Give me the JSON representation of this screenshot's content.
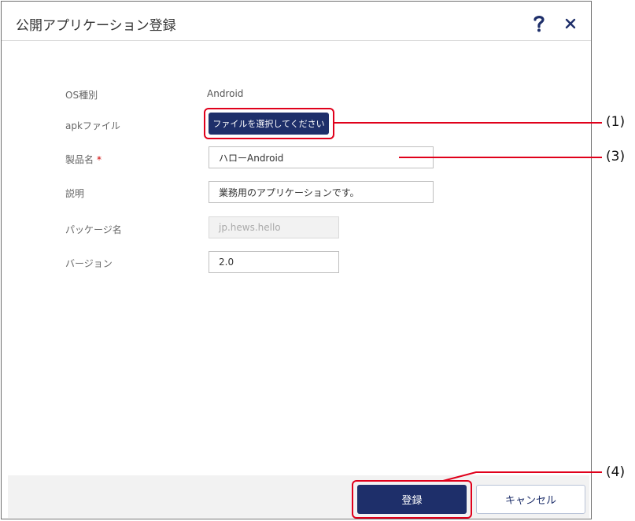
{
  "dialog": {
    "title": "公開アプリケーション登録",
    "help_icon": "help-icon",
    "close_icon": "close-icon"
  },
  "form": {
    "os_type": {
      "label": "OS種別",
      "value": "Android"
    },
    "apk_file": {
      "label": "apkファイル",
      "button_label": "ファイルを選択してください"
    },
    "product_name": {
      "label": "製品名",
      "required_mark": "*",
      "value": "ハローAndroid"
    },
    "description": {
      "label": "説明",
      "value": "業務用のアプリケーションです。"
    },
    "package_name": {
      "label": "パッケージ名",
      "value": "jp.hews.hello"
    },
    "version": {
      "label": "バージョン",
      "value": "2.0"
    }
  },
  "footer": {
    "submit_label": "登録",
    "cancel_label": "キャンセル"
  },
  "callouts": {
    "c1": "(1)",
    "c3": "(3)",
    "c4": "(4)",
    "color": "#e0001b"
  },
  "colors": {
    "primary": "#1e2f6a",
    "required": "#cc0000"
  }
}
